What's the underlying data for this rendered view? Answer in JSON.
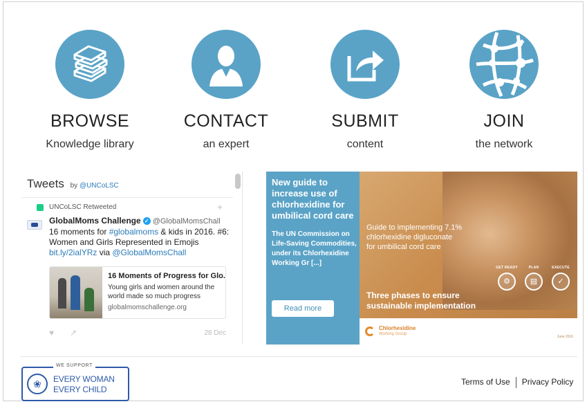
{
  "actions": [
    {
      "title": "BROWSE",
      "subtitle": "Knowledge library",
      "icon": "books-icon"
    },
    {
      "title": "CONTACT",
      "subtitle": "an expert",
      "icon": "person-icon"
    },
    {
      "title": "SUBMIT",
      "subtitle": "content",
      "icon": "share-arrow-icon"
    },
    {
      "title": "JOIN",
      "subtitle": "the network",
      "icon": "network-globe-icon"
    }
  ],
  "tweets": {
    "heading": "Tweets",
    "by": "by",
    "handle": "@UNCoLSC",
    "retweeted_label": "UNCoLSC Retweeted",
    "tweet": {
      "author": "GlobalMoms Challenge",
      "author_handle": "@GlobalMomsChall",
      "text_prefix": "16 moments for ",
      "hashtag": "#globalmoms",
      "text_mid": " & kids in 2016. #6: Women and Girls Represented in Emojis ",
      "link": "bit.ly/2ialYRz",
      "text_via": " via ",
      "mention": "@GlobalMomsChall",
      "date": "28 Dec"
    },
    "card": {
      "title": "16 Moments of Progress for Glo...",
      "description": "Young girls and women around the world made so much progress",
      "url": "globalmomschallenge.org"
    }
  },
  "banner": {
    "title": "New guide to increase use of chlorhexidine for umbilical cord care",
    "body": "The UN Commission on Life-Saving Commodities, under its Chlorhexidine Working Gr [...]",
    "button": "Read more",
    "guide_text": "Guide to implementing 7.1% chlorhexidine digluconate for umbilical cord care",
    "phases": [
      "GET READY",
      "PLAN",
      "EXECUTE"
    ],
    "three_phases": "Three phases to ensure sustainable implementation",
    "logo_name": "Chlorhexidine",
    "logo_sub": "Working Group",
    "date": "June 2016"
  },
  "footer": {
    "we_support": "WE SUPPORT",
    "ewec_line1": "EVERY WOMAN",
    "ewec_line2": "EVERY CHILD",
    "terms": "Terms of Use",
    "privacy": "Privacy Policy"
  },
  "colors": {
    "accent_blue": "#5aa3c7",
    "banner_orange": "#c98c4d",
    "link_blue": "#2b7bb9",
    "ewec_blue": "#2d5aa8"
  }
}
